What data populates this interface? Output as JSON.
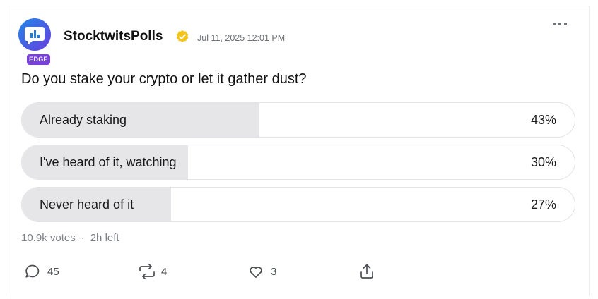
{
  "post": {
    "username": "StocktwitsPolls",
    "badge": "EDGE",
    "timestamp": "Jul 11, 2025 12:01 PM",
    "question": "Do you stake your crypto or let it gather dust?"
  },
  "poll": {
    "options": [
      {
        "label": "Already staking",
        "percent_label": "43%",
        "percent": 43
      },
      {
        "label": "I've heard of it, watching",
        "percent_label": "30%",
        "percent": 30
      },
      {
        "label": "Never heard of it",
        "percent_label": "27%",
        "percent": 27
      }
    ],
    "votes": "10.9k votes",
    "separator": "·",
    "time_left": "2h left"
  },
  "actions": {
    "comments": "45",
    "reposts": "4",
    "likes": "3"
  },
  "icons": {
    "avatar": "chat-bubble-bar-chart-icon",
    "verified": "verified-check-icon",
    "more": "more-dots-icon",
    "comment": "comment-icon",
    "repost": "repost-icon",
    "like": "heart-icon",
    "share": "share-icon"
  },
  "colors": {
    "verified_badge": "#f2c318",
    "edge_badge": "#7a3fe0",
    "poll_fill": "#e6e6e9"
  }
}
